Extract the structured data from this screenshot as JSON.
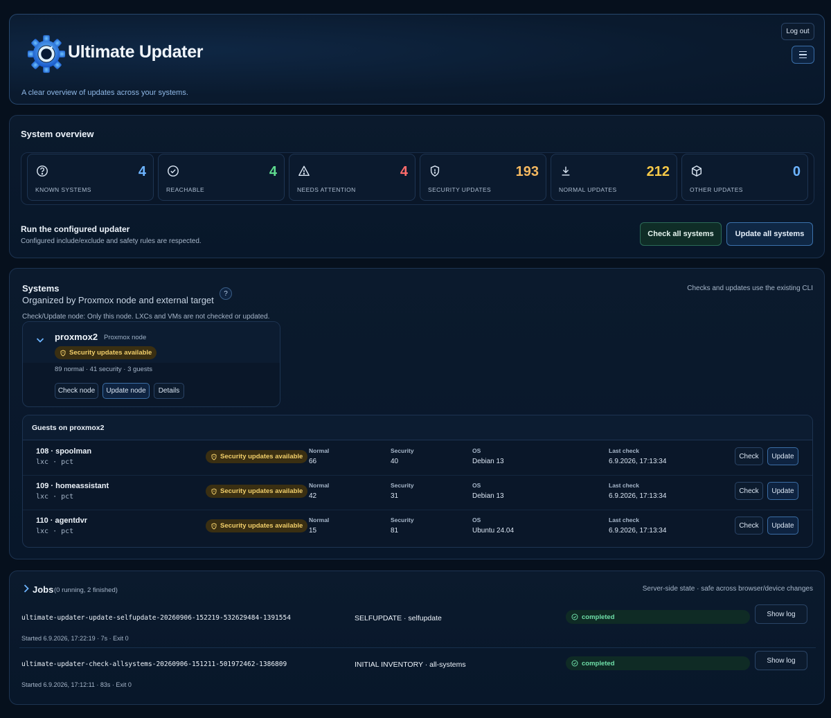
{
  "header": {
    "title": "Ultimate Updater",
    "tagline": "A clear overview of updates across your systems.",
    "logout_label": "Log out"
  },
  "overview": {
    "title": "System overview",
    "stats": [
      {
        "icon": "question-circle-icon",
        "value": "4",
        "label": "KNOWN SYSTEMS",
        "color": "#6db4ff"
      },
      {
        "icon": "check-circle-icon",
        "value": "4",
        "label": "REACHABLE",
        "color": "#5fdc8f"
      },
      {
        "icon": "warning-icon",
        "value": "4",
        "label": "NEEDS ATTENTION",
        "color": "#ff6b6b"
      },
      {
        "icon": "shield-icon",
        "value": "193",
        "label": "SECURITY UPDATES",
        "color": "#f4b860"
      },
      {
        "icon": "download-icon",
        "value": "212",
        "label": "NORMAL UPDATES",
        "color": "#f7c948"
      },
      {
        "icon": "box-icon",
        "value": "0",
        "label": "OTHER UPDATES",
        "color": "#6db4ff"
      }
    ],
    "run_title": "Run the configured updater",
    "run_subtitle": "Configured include/exclude and safety rules are respected.",
    "check_all_label": "Check all systems",
    "update_all_label": "Update all systems"
  },
  "systems": {
    "title": "Systems",
    "subtitle": "Organized by Proxmox node and external target",
    "help_label": "?",
    "note": "Checks and updates use the existing CLI",
    "hint": "Check/Update node: Only this node. LXCs and VMs are not checked or updated.",
    "node": {
      "name": "proxmox2",
      "type": "Proxmox node",
      "badge": "Security updates available",
      "meta": "89 normal · 41 security · 3 guests",
      "check_label": "Check node",
      "update_label": "Update node",
      "details_label": "Details"
    },
    "guests_title": "Guests on proxmox2",
    "guest_labels": {
      "normal": "Normal",
      "security": "Security",
      "os": "OS",
      "last_check": "Last check"
    },
    "guest_actions": {
      "check": "Check",
      "update": "Update"
    },
    "guests": [
      {
        "name": "108 · spoolman",
        "kind": "lxc · pct",
        "badge": "Security updates available",
        "normal": "66",
        "security": "40",
        "os": "Debian 13",
        "last_check": "6.9.2026, 17:13:34"
      },
      {
        "name": "109 · homeassistant",
        "kind": "lxc · pct",
        "badge": "Security updates available",
        "normal": "42",
        "security": "31",
        "os": "Debian 13",
        "last_check": "6.9.2026, 17:13:34"
      },
      {
        "name": "110 · agentdvr",
        "kind": "lxc · pct",
        "badge": "Security updates available",
        "normal": "15",
        "security": "81",
        "os": "Ubuntu 24.04",
        "last_check": "6.9.2026, 17:13:34"
      }
    ]
  },
  "jobs": {
    "title": "Jobs",
    "count": "(0 running, 2 finished)",
    "note": "Server-side state · safe across browser/device changes",
    "show_log_label": "Show log",
    "items": [
      {
        "id": "ultimate-updater-update-selfupdate-20260906-152219-532629484-1391554",
        "kind": "SELFUPDATE · selfupdate",
        "status": "completed",
        "meta": "Started 6.9.2026, 17:22:19 · 7s · Exit 0"
      },
      {
        "id": "ultimate-updater-check-allsystems-20260906-151211-501972462-1386809",
        "kind": "INITIAL INVENTORY · all-systems",
        "status": "completed",
        "meta": "Started 6.9.2026, 17:12:11 · 83s · Exit 0"
      }
    ]
  }
}
